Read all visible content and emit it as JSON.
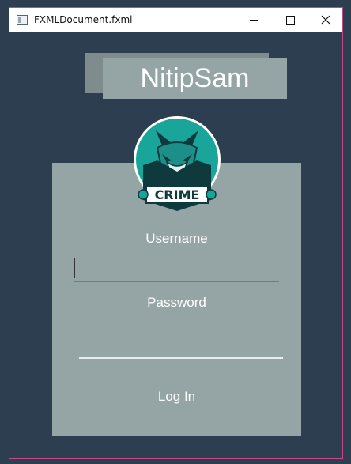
{
  "window": {
    "title": "FXMLDocument.fxml",
    "controls": [
      "minimize",
      "maximize",
      "close"
    ]
  },
  "header": {
    "title": "NitipSam"
  },
  "logo": {
    "text": "CRIME",
    "icon": "fox-crime-logo"
  },
  "form": {
    "username_label": "Username",
    "username_value": "",
    "password_label": "Password",
    "password_value": "",
    "login_label": "Log In"
  },
  "colors": {
    "background": "#2e3e51",
    "panel": "#95a5a6",
    "title_shadow": "#7f8c8d",
    "accent": "#2a9d8f",
    "logo_teal": "#1aa59a"
  }
}
